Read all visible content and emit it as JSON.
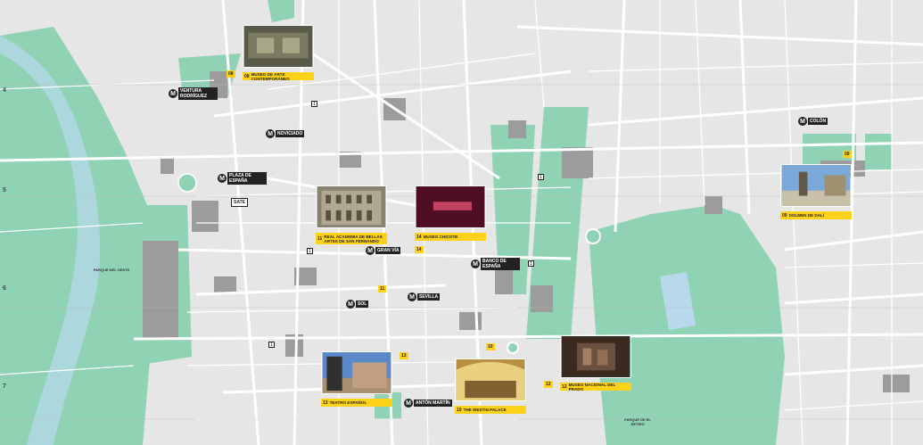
{
  "map": {
    "grid_rows": [
      "4",
      "5",
      "6",
      "7"
    ],
    "metro_stations": [
      {
        "id": "ventura-rodriguez",
        "label": "VENTURA RODRÍGUEZ"
      },
      {
        "id": "noviciado",
        "label": "NOVICIADO"
      },
      {
        "id": "plaza-de-espana",
        "label": "PLAZA DE ESPAÑA"
      },
      {
        "id": "gran-via",
        "label": "GRAN VÍA"
      },
      {
        "id": "banco-de-espana",
        "label": "BANCO DE ESPAÑA"
      },
      {
        "id": "sol",
        "label": "SOL"
      },
      {
        "id": "sevilla",
        "label": "SEVILLA"
      },
      {
        "id": "anton-martin",
        "label": "ANTÓN MARTÍN"
      },
      {
        "id": "colon",
        "label": "COLÓN"
      }
    ],
    "other_labels": [
      {
        "id": "sate",
        "label": "SATE"
      }
    ],
    "points_of_interest": [
      {
        "id": "museo-arte-contemporaneo",
        "num": "08",
        "title": "MUSEO DE ARTE CONTEMPORÁNEO"
      },
      {
        "id": "real-academia",
        "num": "11",
        "title": "REAL ACADEMIA DE BELLAS ARTES DE SAN FERNANDO"
      },
      {
        "id": "museo-chicote",
        "num": "14",
        "title": "MUSEO CHICOTE"
      },
      {
        "id": "dolmen-de-dali",
        "num": "09",
        "title": "DOLMEN DE DALÍ"
      },
      {
        "id": "teatro-espanol",
        "num": "13",
        "title": "TEATRO ESPAÑOL"
      },
      {
        "id": "westin-palace",
        "num": "10",
        "title": "THE WESTIN PALACE"
      },
      {
        "id": "museo-del-prado",
        "num": "12",
        "title": "MUSEO NACIONAL DEL PRADO"
      }
    ],
    "small_badges": [
      "08",
      "14",
      "11",
      "13",
      "10",
      "12",
      "09"
    ],
    "map_squares": [
      "1",
      "1",
      "1",
      "1",
      "1"
    ],
    "park_labels": [
      "PARQUE DEL OESTE",
      "PARQUE DE EL RETIRO"
    ],
    "colors": {
      "background": "#e6e6e6",
      "park": "#8fd3b4",
      "building": "#9c9c9c",
      "street": "#ffffff",
      "water": "#b8d8ec",
      "accent": "#ffd21a",
      "metro": "#222222"
    }
  }
}
